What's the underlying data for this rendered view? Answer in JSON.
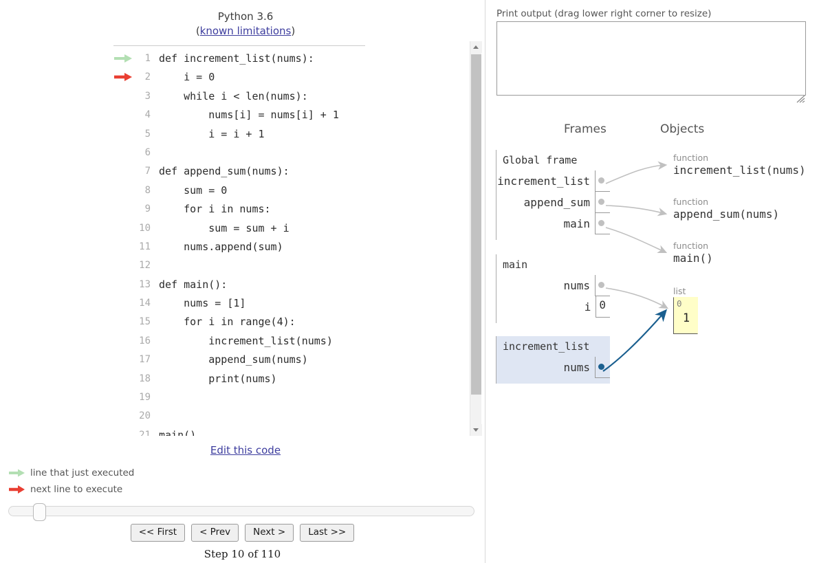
{
  "header": {
    "version_label": "Python 3.6",
    "limitations_prefix": "(",
    "limitations_link": "known limitations",
    "limitations_suffix": ")"
  },
  "code": {
    "lines": [
      {
        "n": "1",
        "text": "def increment_list(nums):",
        "marker": "green-arrow"
      },
      {
        "n": "2",
        "text": "    i = 0",
        "marker": "red-arrow"
      },
      {
        "n": "3",
        "text": "    while i < len(nums):",
        "marker": ""
      },
      {
        "n": "4",
        "text": "        nums[i] = nums[i] + 1",
        "marker": ""
      },
      {
        "n": "5",
        "text": "        i = i + 1",
        "marker": ""
      },
      {
        "n": "6",
        "text": "",
        "marker": ""
      },
      {
        "n": "7",
        "text": "def append_sum(nums):",
        "marker": ""
      },
      {
        "n": "8",
        "text": "    sum = 0",
        "marker": ""
      },
      {
        "n": "9",
        "text": "    for i in nums:",
        "marker": ""
      },
      {
        "n": "10",
        "text": "        sum = sum + i",
        "marker": ""
      },
      {
        "n": "11",
        "text": "    nums.append(sum)",
        "marker": ""
      },
      {
        "n": "12",
        "text": "",
        "marker": ""
      },
      {
        "n": "13",
        "text": "def main():",
        "marker": ""
      },
      {
        "n": "14",
        "text": "    nums = [1]",
        "marker": ""
      },
      {
        "n": "15",
        "text": "    for i in range(4):",
        "marker": ""
      },
      {
        "n": "16",
        "text": "        increment_list(nums)",
        "marker": ""
      },
      {
        "n": "17",
        "text": "        append_sum(nums)",
        "marker": ""
      },
      {
        "n": "18",
        "text": "        print(nums)",
        "marker": ""
      },
      {
        "n": "19",
        "text": "",
        "marker": ""
      },
      {
        "n": "20",
        "text": "",
        "marker": ""
      },
      {
        "n": "21",
        "text": "main()",
        "marker": ""
      }
    ]
  },
  "edit": {
    "link_label": "Edit this code"
  },
  "legend": {
    "just_executed": "line that just executed",
    "next_line": "next line to execute"
  },
  "controls": {
    "first_label": "<< First",
    "prev_label": "< Prev",
    "next_label": "Next >",
    "last_label": "Last >>",
    "step_label": "Step 10 of 110",
    "step_current": 10,
    "step_total": 110
  },
  "print_output": {
    "label": "Print output (drag lower right corner to resize)",
    "value": ""
  },
  "visualization": {
    "frames_header": "Frames",
    "objects_header": "Objects",
    "frames": [
      {
        "title": "Global frame",
        "highlighted": false,
        "vars": [
          {
            "name": "increment_list",
            "value": "",
            "is_pointer": true,
            "pointer_color": "gray"
          },
          {
            "name": "append_sum",
            "value": "",
            "is_pointer": true,
            "pointer_color": "gray"
          },
          {
            "name": "main",
            "value": "",
            "is_pointer": true,
            "pointer_color": "gray"
          }
        ]
      },
      {
        "title": "main",
        "highlighted": false,
        "vars": [
          {
            "name": "nums",
            "value": "",
            "is_pointer": true,
            "pointer_color": "gray"
          },
          {
            "name": "i",
            "value": "0",
            "is_pointer": false,
            "pointer_color": ""
          }
        ]
      },
      {
        "title": "increment_list",
        "highlighted": true,
        "vars": [
          {
            "name": "nums",
            "value": "",
            "is_pointer": true,
            "pointer_color": "blue"
          }
        ]
      }
    ],
    "objects": [
      {
        "type": "function",
        "body": "increment_list(nums)"
      },
      {
        "type": "function",
        "body": "append_sum(nums)"
      },
      {
        "type": "function",
        "body": "main()"
      }
    ],
    "list_object": {
      "type": "list",
      "indices": [
        "0"
      ],
      "elements": [
        "1"
      ]
    }
  },
  "colors": {
    "just_executed_arrow": "#b3dfb3",
    "next_line_arrow": "#e93f33",
    "highlight_frame_bg": "#dfe6f3",
    "list_bg": "#fffec8",
    "pointer_gray": "#c0c0c0",
    "pointer_blue": "#1a5f8f",
    "link": "#3d3d9e"
  }
}
